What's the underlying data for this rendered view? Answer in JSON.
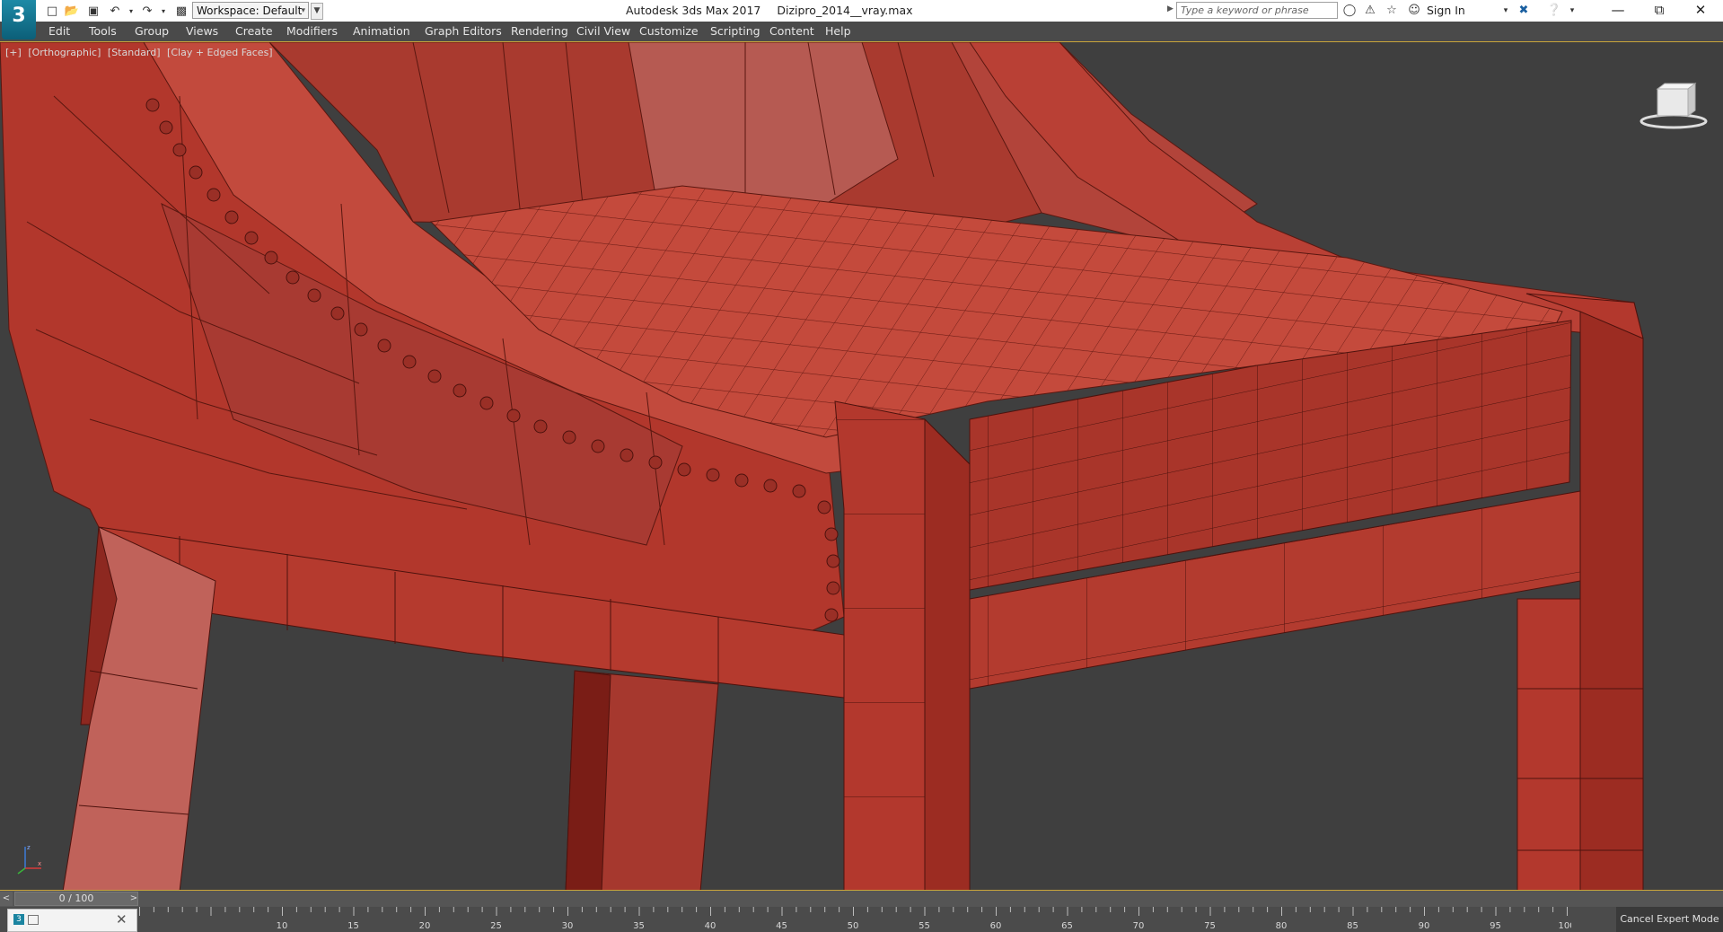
{
  "app": {
    "logo_text": "3",
    "title": "Autodesk 3ds Max 2017",
    "filename": "Dizipro_2014__vray.max"
  },
  "quick_access": {
    "workspace_label": "Workspace: Default"
  },
  "search": {
    "placeholder": "Type a keyword or phrase"
  },
  "account": {
    "signin_label": "Sign In"
  },
  "menu": {
    "items": [
      "Edit",
      "Tools",
      "Group",
      "Views",
      "Create",
      "Modifiers",
      "Animation",
      "Graph Editors",
      "Rendering",
      "Civil View",
      "Customize",
      "Scripting",
      "Content",
      "Help"
    ]
  },
  "viewport": {
    "label_plus": "[+]",
    "label_view": "[Orthographic]",
    "label_shading": "[Standard]",
    "label_style": "[Clay + Edged Faces]",
    "background_color": "#3f3f3f",
    "model_color": "#b8483a"
  },
  "timeline": {
    "frame_display": "0 / 100",
    "prev": "<",
    "next": ">",
    "ticks": [
      "10",
      "15",
      "20",
      "25",
      "30",
      "35",
      "40",
      "45",
      "50",
      "55",
      "60",
      "65",
      "70",
      "75",
      "80",
      "85",
      "90",
      "95",
      "100"
    ]
  },
  "status": {
    "cancel_expert_label": "Cancel Expert Mode"
  },
  "colors": {
    "accent": "#c9a53b",
    "menu_bg": "#4a4a4a",
    "logo": "#1e8aa6"
  }
}
